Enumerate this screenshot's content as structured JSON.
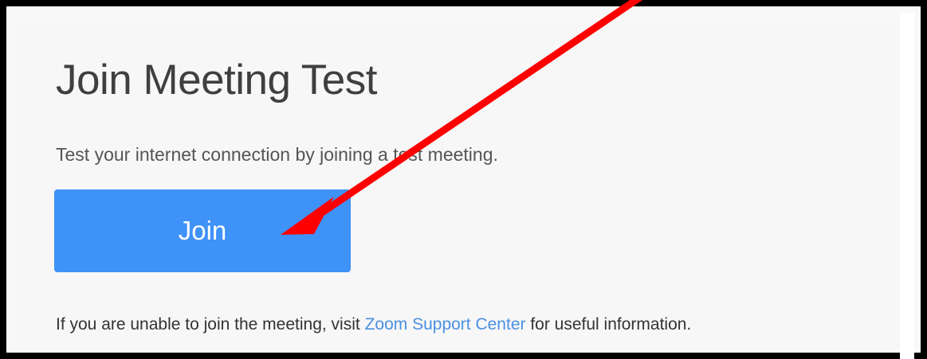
{
  "page": {
    "title": "Join Meeting Test",
    "description": "Test your internet connection by joining a test meeting.",
    "join_button_label": "Join",
    "help_prefix": "If you are unable to join the meeting, visit ",
    "help_link_text": "Zoom Support Center",
    "help_suffix": " for useful information."
  },
  "annotation": {
    "icon": "red-arrow-icon"
  },
  "colors": {
    "frame": "#000000",
    "background": "#f7f7f7",
    "button": "#3f92f8",
    "link": "#4a90e2",
    "arrow": "#ff0000"
  }
}
